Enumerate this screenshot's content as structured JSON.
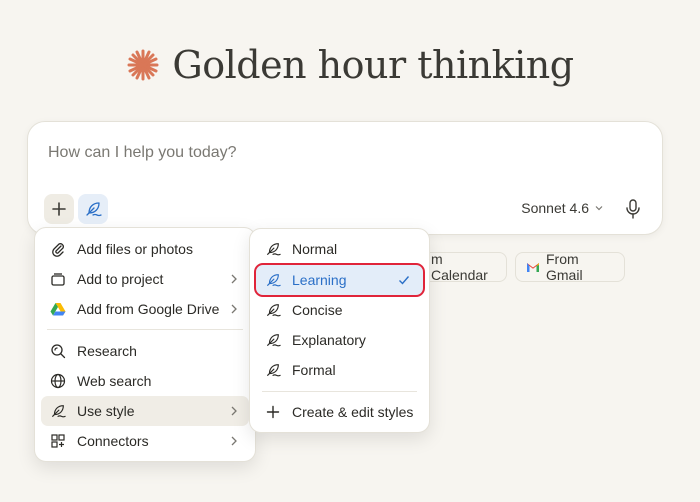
{
  "header": {
    "title": "Golden hour thinking",
    "spark_color": "#d97757"
  },
  "composer": {
    "placeholder": "How can I help you today?",
    "model_label": "Sonnet 4.6"
  },
  "chips": [
    {
      "label": "m Calendar"
    },
    {
      "label": "From Gmail"
    }
  ],
  "add_menu": {
    "items": [
      {
        "label": "Add files or photos",
        "icon": "paperclip-icon"
      },
      {
        "label": "Add to project",
        "icon": "project-icon"
      },
      {
        "label": "Add from Google Drive",
        "icon": "google-drive-icon"
      },
      {
        "label": "Research",
        "icon": "research-icon"
      },
      {
        "label": "Web search",
        "icon": "globe-icon"
      },
      {
        "label": "Use style",
        "icon": "feather-icon"
      },
      {
        "label": "Connectors",
        "icon": "connectors-icon"
      }
    ]
  },
  "style_menu": {
    "items": [
      {
        "label": "Normal"
      },
      {
        "label": "Learning",
        "selected": true
      },
      {
        "label": "Concise"
      },
      {
        "label": "Explanatory"
      },
      {
        "label": "Formal"
      }
    ],
    "create_label": "Create & edit styles"
  },
  "colors": {
    "accent_blue": "#2a6fc7",
    "highlight_red": "#e0243a",
    "background": "#f7f5f0"
  }
}
